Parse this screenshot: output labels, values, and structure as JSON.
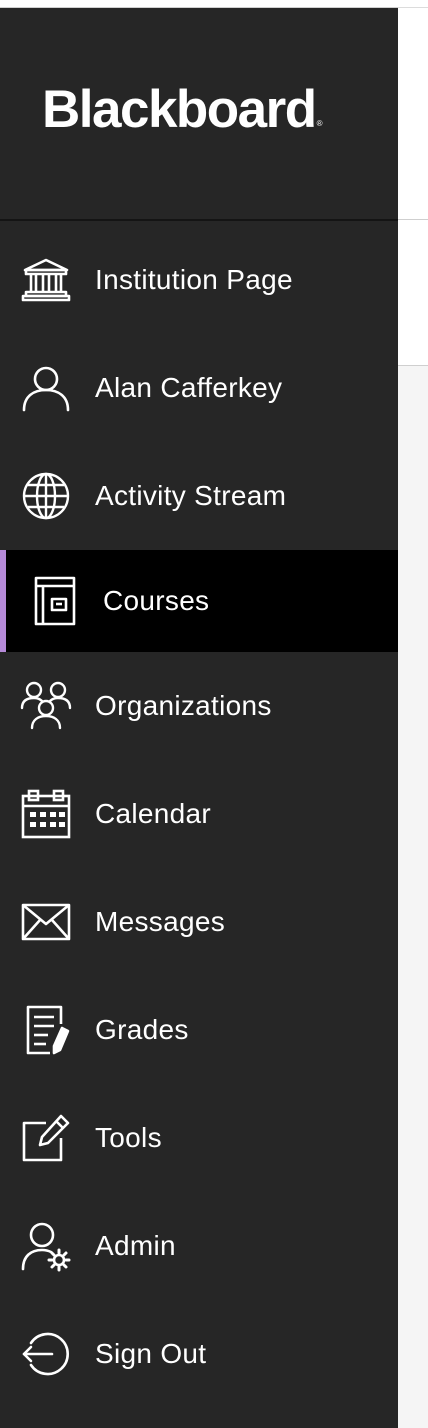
{
  "brand": {
    "logo_text": "Blackboard",
    "logo_mark": "®"
  },
  "colors": {
    "sidebar_bg": "#262626",
    "active_bg": "#000000",
    "active_accent": "#b58ad8",
    "text": "#ffffff"
  },
  "nav": {
    "items": [
      {
        "label": "Institution Page",
        "icon": "institution-icon"
      },
      {
        "label": "Alan Cafferkey",
        "icon": "user-icon"
      },
      {
        "label": "Activity Stream",
        "icon": "globe-icon"
      },
      {
        "label": "Courses",
        "icon": "courses-icon",
        "active": true
      },
      {
        "label": "Organizations",
        "icon": "organizations-icon"
      },
      {
        "label": "Calendar",
        "icon": "calendar-icon"
      },
      {
        "label": "Messages",
        "icon": "envelope-icon"
      },
      {
        "label": "Grades",
        "icon": "grades-icon"
      },
      {
        "label": "Tools",
        "icon": "tools-icon"
      },
      {
        "label": "Admin",
        "icon": "admin-icon"
      },
      {
        "label": "Sign Out",
        "icon": "sign-out-icon"
      }
    ]
  }
}
